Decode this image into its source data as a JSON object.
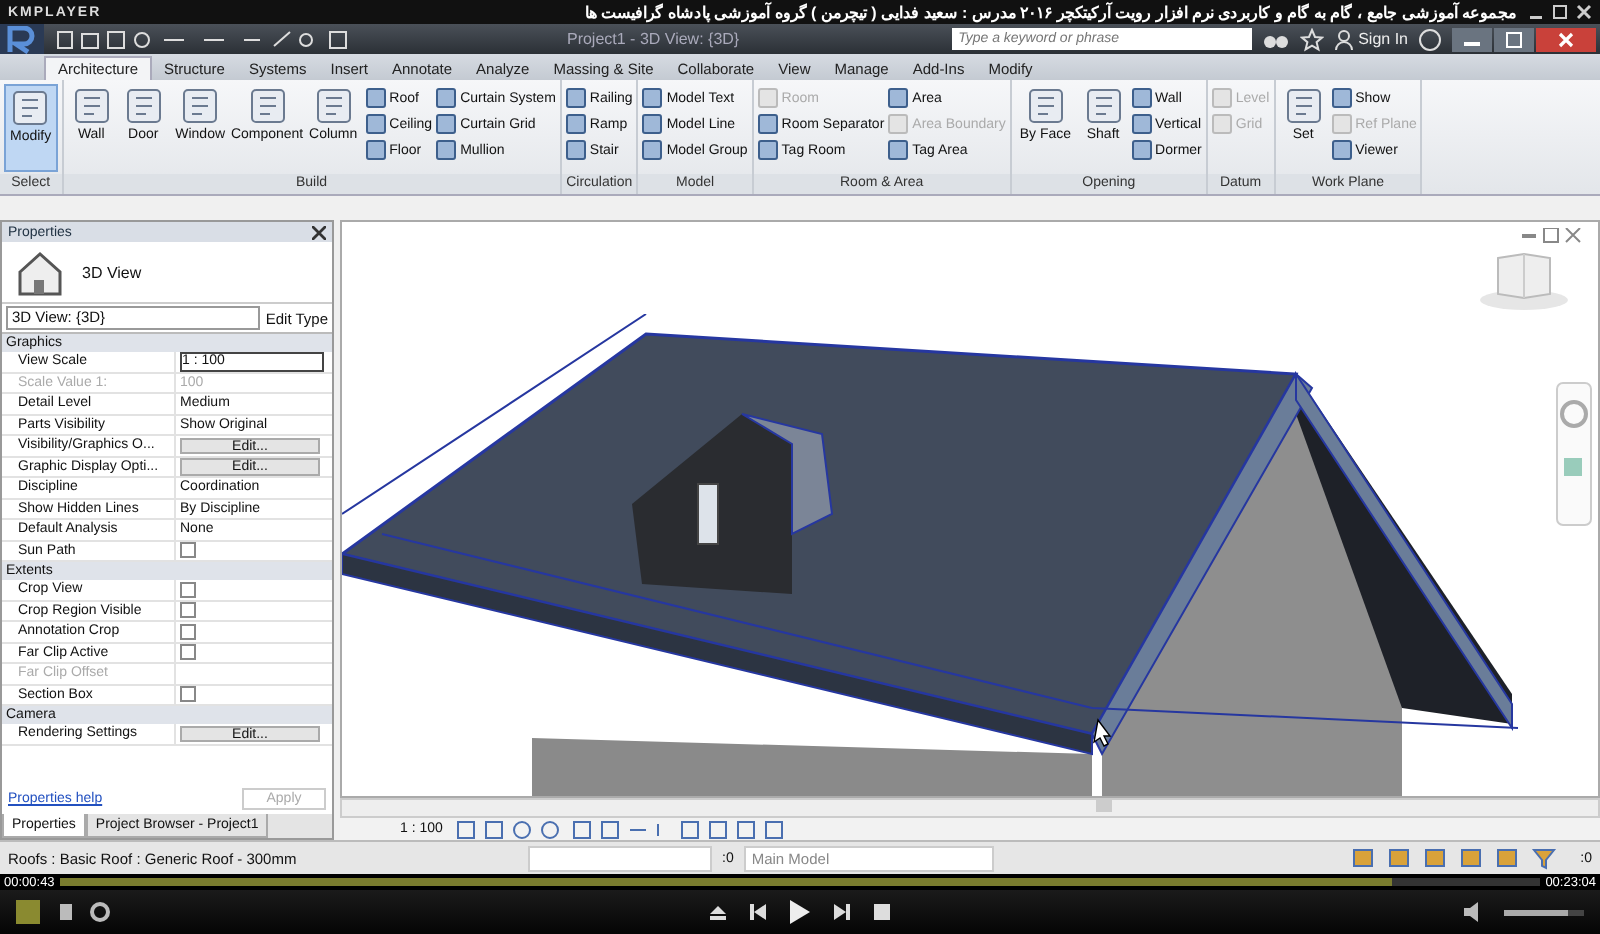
{
  "player": {
    "name": "KMPLAYER",
    "title": "مجموعه آموزشی جامع ، گام به گام و کاربردی نرم افزار رویت آرکیتکچر ۲۰۱۶ مدرس : سعید فدایی ( تیچرمن ) گروه آموزشی پادشاه گرافیست ها",
    "elapsed": "00:00:43",
    "total": "00:23:04",
    "level": 0.9,
    "volume": {
      "level": 0.8
    }
  },
  "app": {
    "title": "Project1 - 3D View: {3D}",
    "search": {
      "placeholder": "Type a keyword or phrase"
    },
    "sign_in": "Sign In"
  },
  "tabs": [
    {
      "label": "Architecture",
      "selected": true
    },
    {
      "label": "Structure",
      "selected": false
    },
    {
      "label": "Systems",
      "selected": false
    },
    {
      "label": "Insert",
      "selected": false
    },
    {
      "label": "Annotate",
      "selected": false
    },
    {
      "label": "Analyze",
      "selected": false
    },
    {
      "label": "Massing & Site",
      "selected": false
    },
    {
      "label": "Collaborate",
      "selected": false
    },
    {
      "label": "View",
      "selected": false
    },
    {
      "label": "Manage",
      "selected": false
    },
    {
      "label": "Add-Ins",
      "selected": false
    },
    {
      "label": "Modify",
      "selected": false
    }
  ],
  "panels": [
    {
      "title": "Select",
      "large": [
        {
          "label": "Modify",
          "selected": true
        }
      ]
    },
    {
      "title": "Build",
      "large": [
        {
          "label": "Wall",
          "selected": false
        },
        {
          "label": "Door",
          "selected": false
        },
        {
          "label": "Window",
          "selected": false
        },
        {
          "label": "Component",
          "selected": false
        },
        {
          "label": "Column",
          "selected": false
        }
      ],
      "columns": [
        [
          {
            "label": "Roof",
            "disabled": false
          },
          {
            "label": "Ceiling",
            "disabled": false
          },
          {
            "label": "Floor",
            "disabled": false
          }
        ],
        [
          {
            "label": "Curtain System",
            "disabled": false
          },
          {
            "label": "Curtain Grid",
            "disabled": false
          },
          {
            "label": "Mullion",
            "disabled": false
          }
        ]
      ]
    },
    {
      "title": "Circulation",
      "columns": [
        [
          {
            "label": "Railing",
            "disabled": false
          },
          {
            "label": "Ramp",
            "disabled": false
          },
          {
            "label": "Stair",
            "disabled": false
          }
        ]
      ]
    },
    {
      "title": "Model",
      "columns": [
        [
          {
            "label": "Model Text",
            "disabled": false
          },
          {
            "label": "Model Line",
            "disabled": false
          },
          {
            "label": "Model Group",
            "disabled": false
          }
        ]
      ]
    },
    {
      "title": "Room & Area",
      "columns": [
        [
          {
            "label": "Room",
            "disabled": true
          },
          {
            "label": "Room Separator",
            "disabled": false
          },
          {
            "label": "Tag Room",
            "disabled": false
          }
        ],
        [
          {
            "label": "Area",
            "disabled": false
          },
          {
            "label": "Area Boundary",
            "disabled": true
          },
          {
            "label": "Tag Area",
            "disabled": false
          }
        ]
      ]
    },
    {
      "title": "Opening",
      "large": [
        {
          "label": "By Face",
          "selected": false
        },
        {
          "label": "Shaft",
          "selected": false
        }
      ],
      "columns": [
        [
          {
            "label": "Wall",
            "disabled": false
          },
          {
            "label": "Vertical",
            "disabled": false
          },
          {
            "label": "Dormer",
            "disabled": false
          }
        ]
      ]
    },
    {
      "title": "Datum",
      "columns": [
        [
          {
            "label": "Level",
            "disabled": true
          },
          {
            "label": "Grid",
            "disabled": true
          }
        ]
      ]
    },
    {
      "title": "Work Plane",
      "large": [
        {
          "label": "Set",
          "selected": false
        }
      ],
      "columns": [
        [
          {
            "label": "Show",
            "disabled": false
          },
          {
            "label": "Ref Plane",
            "disabled": true
          },
          {
            "label": "Viewer",
            "disabled": false
          }
        ]
      ]
    }
  ],
  "properties": {
    "title": "Properties",
    "type_name": "3D View",
    "selector": "3D View: {3D}",
    "edit_type": "Edit Type",
    "sections": [
      {
        "name": "Graphics",
        "rows": [
          {
            "label": "View Scale",
            "value": "1 : 100",
            "kind": "input",
            "disabled": false
          },
          {
            "label": "Scale Value    1:",
            "value": "100",
            "kind": "text",
            "disabled": true
          },
          {
            "label": "Detail Level",
            "value": "Medium",
            "kind": "text",
            "disabled": false
          },
          {
            "label": "Parts Visibility",
            "value": "Show Original",
            "kind": "text",
            "disabled": false
          },
          {
            "label": "Visibility/Graphics O...",
            "value": "Edit...",
            "kind": "button",
            "disabled": false
          },
          {
            "label": "Graphic Display Opti...",
            "value": "Edit...",
            "kind": "button",
            "disabled": false
          },
          {
            "label": "Discipline",
            "value": "Coordination",
            "kind": "text",
            "disabled": false
          },
          {
            "label": "Show Hidden Lines",
            "value": "By Discipline",
            "kind": "text",
            "disabled": false
          },
          {
            "label": "Default Analysis",
            "value": "None",
            "kind": "text",
            "disabled": false
          },
          {
            "label": "Sun Path",
            "kind": "check",
            "checked": false,
            "disabled": false
          }
        ]
      },
      {
        "name": "Extents",
        "rows": [
          {
            "label": "Crop View",
            "kind": "check",
            "checked": false,
            "disabled": false
          },
          {
            "label": "Crop Region Visible",
            "kind": "check",
            "checked": false,
            "disabled": false
          },
          {
            "label": "Annotation Crop",
            "kind": "check",
            "checked": false,
            "disabled": false
          },
          {
            "label": "Far Clip Active",
            "kind": "check",
            "checked": false,
            "disabled": false
          },
          {
            "label": "Far Clip Offset",
            "kind": "text",
            "disabled": true
          },
          {
            "label": "Section Box",
            "kind": "check",
            "checked": false,
            "disabled": false
          }
        ]
      },
      {
        "name": "Camera",
        "rows": [
          {
            "label": "Rendering Settings",
            "value": "Edit...",
            "kind": "button",
            "disabled": false
          }
        ]
      }
    ],
    "help": "Properties help",
    "apply": "Apply"
  },
  "panel_tabs": [
    {
      "label": "Properties",
      "selected": true
    },
    {
      "label": "Project Browser - Project1",
      "selected": false
    }
  ],
  "view": {
    "scale": "1 : 100"
  },
  "status": {
    "text": "Roofs : Basic Roof : Generic Roof - 300mm",
    "selection_count": ":0",
    "model": "Main Model",
    "filter_count": ":0"
  }
}
